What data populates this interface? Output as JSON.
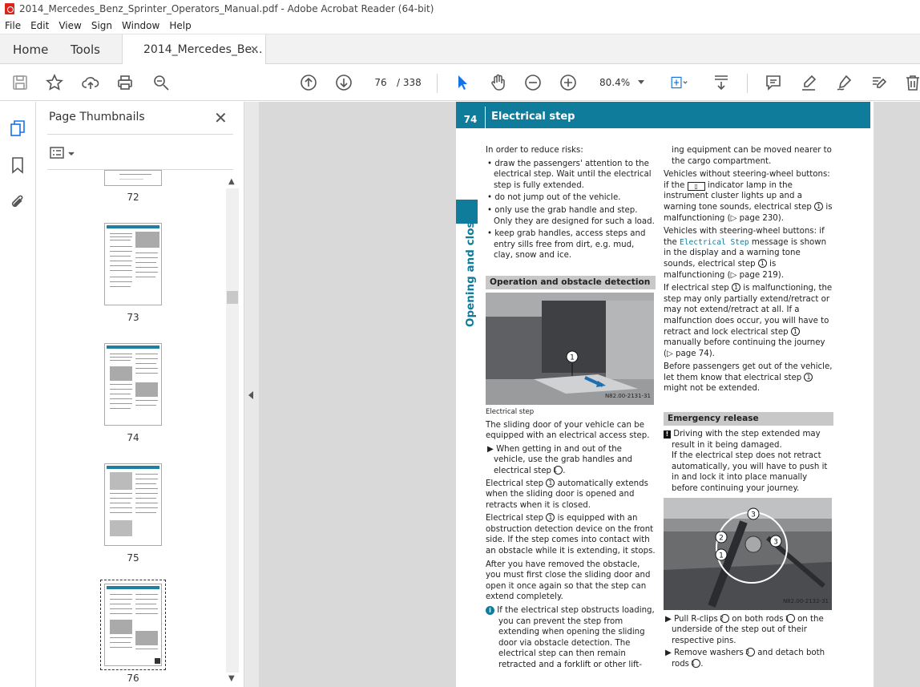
{
  "window": {
    "title": "2014_Mercedes_Benz_Sprinter_Operators_Manual.pdf - Adobe Acrobat Reader (64-bit)"
  },
  "menu": [
    "File",
    "Edit",
    "View",
    "Sign",
    "Window",
    "Help"
  ],
  "tabs": {
    "home": "Home",
    "tools": "Tools",
    "document": "2014_Mercedes_Be..."
  },
  "toolbar": {
    "page_current": "76",
    "page_total": "/  338",
    "zoom": "80.4%"
  },
  "sidebar": {
    "title": "Page Thumbnails",
    "thumbnails": [
      {
        "label": "72"
      },
      {
        "label": "73"
      },
      {
        "label": "74"
      },
      {
        "label": "75"
      },
      {
        "label": "76"
      }
    ]
  },
  "page": {
    "number": "74",
    "title": "Electrical step",
    "side_tab": "Opening and closing",
    "left": {
      "intro": "In order to reduce risks:",
      "bullets": [
        "draw the passengers' attention to the electrical step. Wait until the electrical step is fully extended.",
        "do not jump out of the vehicle.",
        "only use the grab handle and step. Only they are designed for such a load.",
        "keep grab handles, access steps and entry sills free from dirt, e.g. mud, clay, snow and ice."
      ],
      "section": "Operation and obstacle detection",
      "photo_code": "N82.00-2131-31",
      "caption": "Electrical step",
      "p1": "The sliding door of your vehicle can be equipped with an electrical access step.",
      "instr1a": "When getting in and out of the vehicle, use the grab handles and electrical step",
      "p2a": "Electrical step",
      "p2b": "automatically extends when the sliding door is opened and retracts when it is closed.",
      "p3a": "Electrical step",
      "p3b": "is equipped with an obstruction detection device on the front side. If the step comes into contact with an obstacle while it is extending, it stops.",
      "p4": "After you have removed the obstacle, you must first close the sliding door and open it once again so that the step can extend completely.",
      "info": "If the electrical step obstructs loading, you can prevent the step from extending when opening the sliding door via obstacle detection. The electrical step can then remain retracted and a forklift or other lift-"
    },
    "right": {
      "cont": "ing equipment can be moved nearer to the cargo compartment.",
      "p1a": "Vehicles without steering-wheel buttons: if the",
      "p1b": "indicator lamp in the instrument cluster lights up and a warning tone sounds, electrical step",
      "p1c": "is malfunctioning (▷ page 230).",
      "p2a": "Vehicles with steering-wheel buttons: if the",
      "p2mono": "Electrical Step",
      "p2b": "message is shown in the display and a warning tone sounds, electrical step",
      "p2c": "is malfunctioning (▷ page 219).",
      "p3a": "If electrical step",
      "p3b": "is malfunctioning, the step may only partially extend/retract or may not extend/retract at all. If a malfunction does occur, you will have to retract and lock electrical step",
      "p3c": "manually before continuing the journey (▷ page 74).",
      "p4a": "Before passengers get out of the vehicle, let them know that electrical step",
      "p4b": "might not be extended.",
      "section": "Emergency release",
      "warn": "Driving with the step extended may result in it being damaged.",
      "warn2": "If the electrical step does not retract automatically, you will have to push it in and lock it into place manually before continuing your journey.",
      "photo_code": "N82.00-2132-31",
      "s1a": "Pull R-clips",
      "s1b": "on both rods",
      "s1c": "on the underside of the step out of their respective pins.",
      "s2a": "Remove washers",
      "s2b": "and detach both rods"
    },
    "markers": {
      "one": "1",
      "two": "2",
      "three": "3",
      "period": "."
    }
  }
}
